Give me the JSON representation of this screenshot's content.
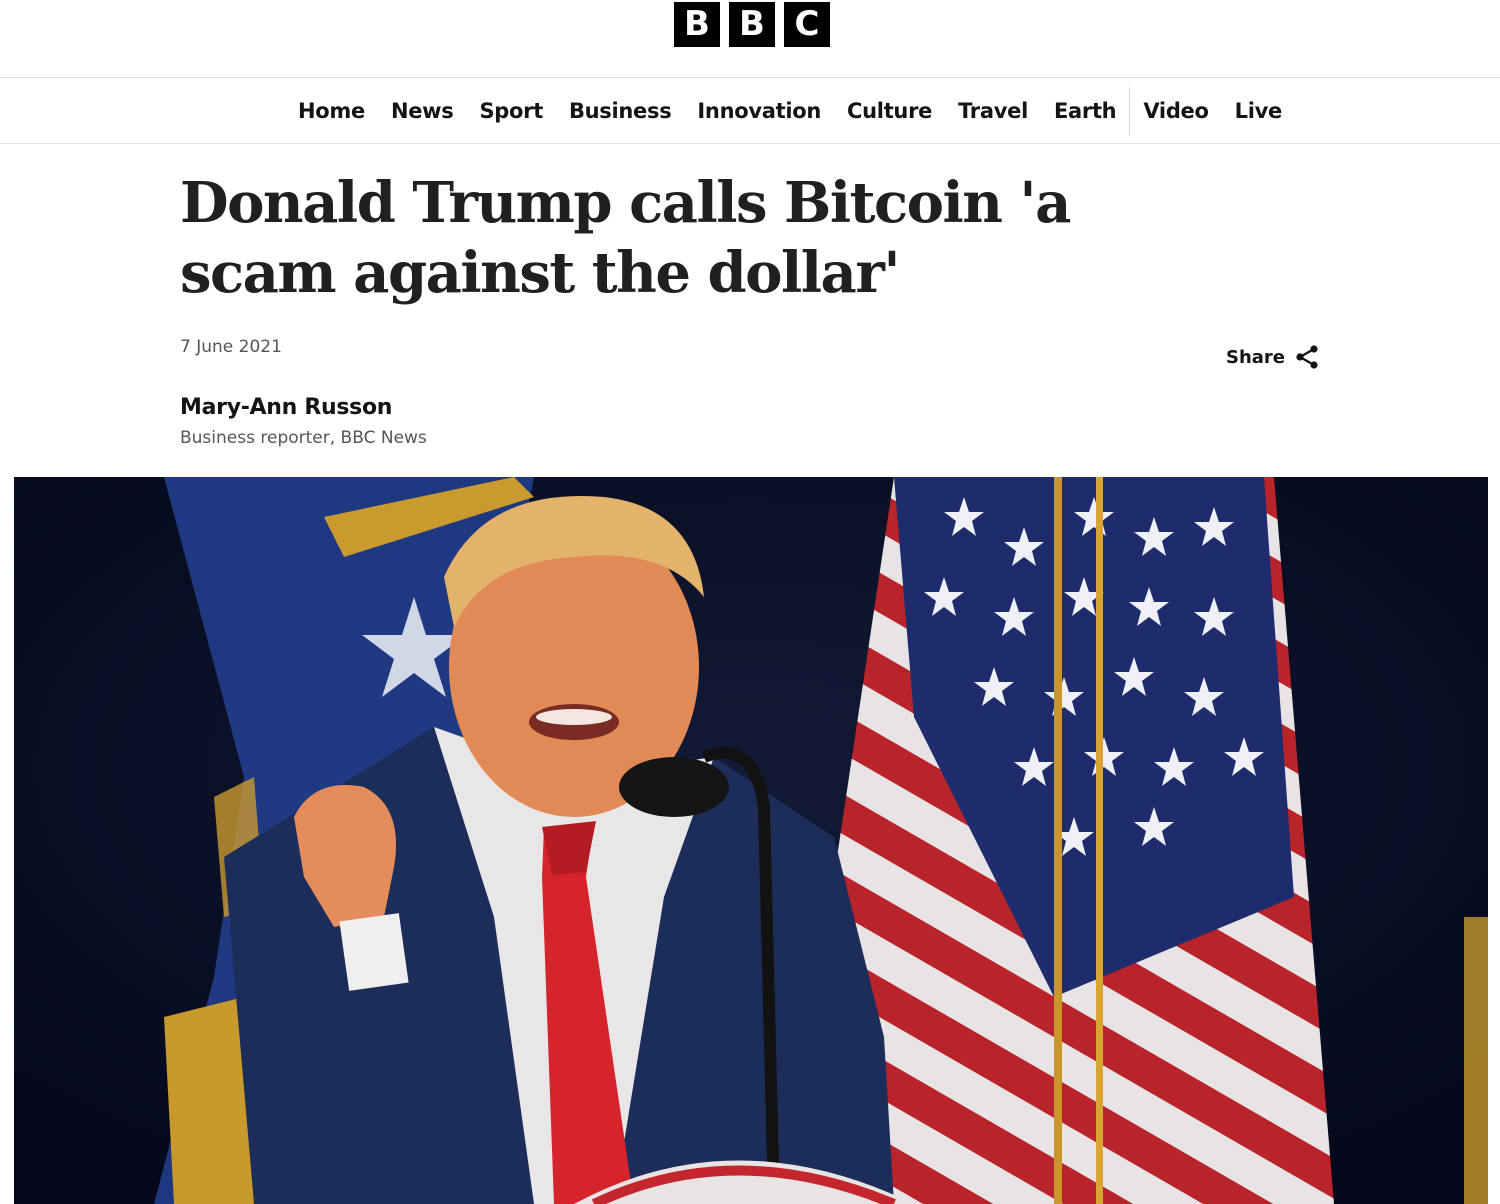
{
  "masthead": {
    "logo_letters": [
      "B",
      "B",
      "C"
    ]
  },
  "nav": {
    "items": [
      "Home",
      "News",
      "Sport",
      "Business",
      "Innovation",
      "Culture",
      "Travel",
      "Earth"
    ],
    "secondary_items": [
      "Video",
      "Live"
    ]
  },
  "article": {
    "headline": "Donald Trump calls Bitcoin 'a scam against the dollar'",
    "date": "7 June 2021",
    "share_label": "Share",
    "byline": {
      "name": "Mary-Ann Russon",
      "role": "Business reporter, BBC News"
    }
  },
  "hero_image": {
    "subject": "man-speaking-at-podium-with-flags"
  },
  "colors": {
    "text_primary": "#141414",
    "text_secondary": "#545658",
    "logo_block": "#000000",
    "divider": "#dcdcdc"
  }
}
